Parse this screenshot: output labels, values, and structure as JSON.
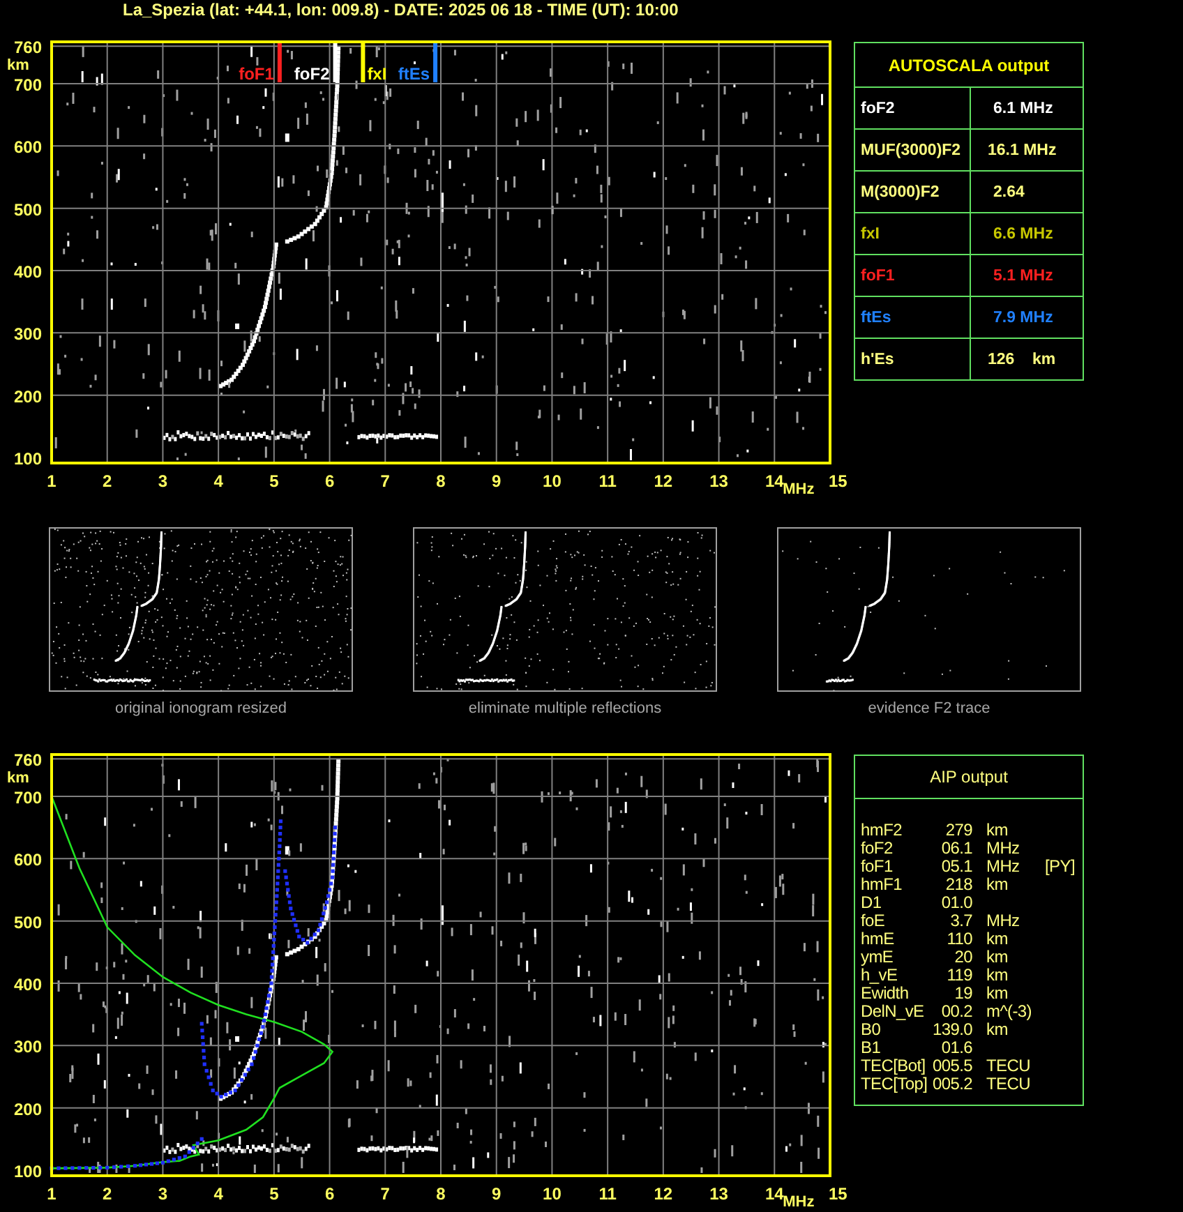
{
  "title": "La_Spezia (lat: +44.1, lon: 009.8) - DATE: 2025 06 18 - TIME (UT): 10:00",
  "top_chart": {
    "markers": [
      {
        "label": "foF1",
        "color": "#ff2020",
        "level": 0.2929
      },
      {
        "label": "foF2",
        "color": "#ffffff",
        "level": 0.3643
      },
      {
        "label": "fxI",
        "color": "#ffff00",
        "level": 0.4
      },
      {
        "label": "ftEs",
        "color": "#2080ff",
        "level": 0.4929
      }
    ],
    "y_axis": {
      "unit": "km",
      "labels": [
        "760",
        "700",
        "600",
        "500",
        "400",
        "300",
        "200",
        "100"
      ]
    },
    "x_axis": {
      "unit": "MHz",
      "labels": [
        "1",
        "2",
        "3",
        "4",
        "5",
        "6",
        "7",
        "8",
        "9",
        "10",
        "11",
        "12",
        "13",
        "14",
        "15"
      ]
    }
  },
  "autoscala": {
    "title": "AUTOSCALA output",
    "rows": [
      {
        "name": "foF2",
        "value": "6.1 MHz",
        "color": "#ffffff"
      },
      {
        "name": "MUF(3000)F2",
        "value": "16.1 MHz",
        "color": "#ffff80"
      },
      {
        "name": "M(3000)F2",
        "value": "2.64",
        "color": "#ffff80"
      },
      {
        "name": "fxI",
        "value": "6.6 MHz",
        "color": "#c8c800"
      },
      {
        "name": "foF1",
        "value": "5.1 MHz",
        "color": "#ff2020"
      },
      {
        "name": "ftEs",
        "value": "7.9 MHz",
        "color": "#2080ff"
      },
      {
        "name": "h'Es",
        "value": "126    km",
        "color": "#ffff80"
      }
    ]
  },
  "thumbnails": [
    {
      "caption": "original ionogram resized",
      "kind": "original"
    },
    {
      "caption": "eliminate multiple reflections",
      "kind": "filtered"
    },
    {
      "caption": "evidence F2 trace",
      "kind": "f2"
    }
  ],
  "bottom_chart": {
    "y_axis": {
      "unit": "km",
      "labels": [
        "760",
        "700",
        "600",
        "500",
        "400",
        "300",
        "200",
        "100"
      ]
    },
    "x_axis": {
      "unit": "MHz",
      "labels": [
        "1",
        "2",
        "3",
        "4",
        "5",
        "6",
        "7",
        "8",
        "9",
        "10",
        "11",
        "12",
        "13",
        "14",
        "15"
      ]
    }
  },
  "aip": {
    "title": "AIP output",
    "rows": [
      {
        "name": "hmF2",
        "value": "279",
        "unit": "km"
      },
      {
        "name": "foF2",
        "value": "06.1",
        "unit": "MHz"
      },
      {
        "name": "foF1",
        "value": "05.1",
        "unit": "MHz",
        "flag": "[PY]"
      },
      {
        "name": "hmF1",
        "value": "218",
        "unit": "km"
      },
      {
        "name": "D1",
        "value": "01.0"
      },
      {
        "name": "foE",
        "value": "3.7",
        "unit": "MHz"
      },
      {
        "name": "hmE",
        "value": "110",
        "unit": "km"
      },
      {
        "name": "ymE",
        "value": "20",
        "unit": "km"
      },
      {
        "name": "h_vE",
        "value": "119",
        "unit": "km"
      },
      {
        "name": "Ewidth",
        "value": "19",
        "unit": "km"
      },
      {
        "name": "DelN_vE",
        "value": "00.2",
        "unit": "m^(-3)"
      },
      {
        "name": "B0",
        "value": "139.0",
        "unit": "km"
      },
      {
        "name": "B1",
        "value": "01.6"
      },
      {
        "name": "TEC[Bot]",
        "value": "005.5",
        "unit": "TECU"
      },
      {
        "name": "TEC[Top]",
        "value": "005.2",
        "unit": "TECU"
      }
    ]
  }
}
